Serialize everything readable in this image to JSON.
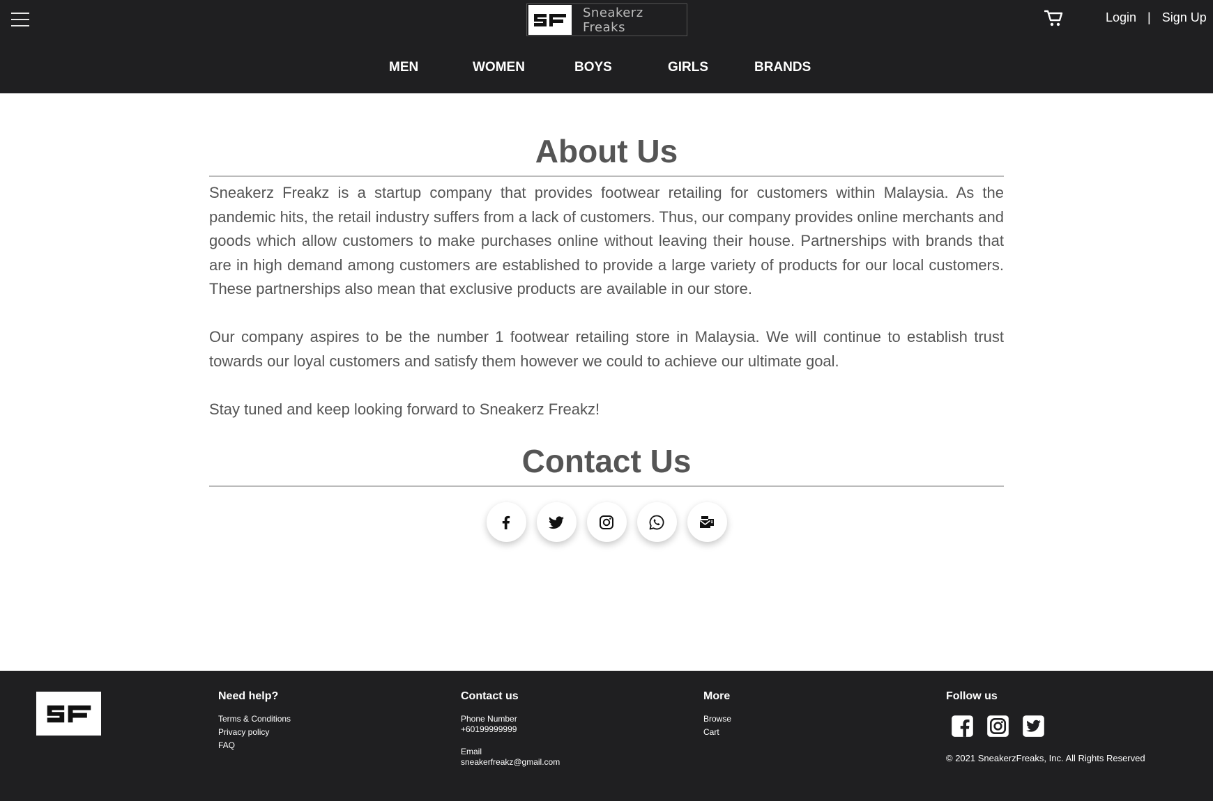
{
  "header": {
    "logo_text": "Sneakerz Freaks",
    "login_label": "Login",
    "separator": "|",
    "signup_label": "Sign Up",
    "nav": [
      "MEN",
      "WOMEN",
      "BOYS",
      "GIRLS",
      "BRANDS"
    ]
  },
  "about": {
    "title": "About Us",
    "paragraphs": [
      "Sneakerz Freakz is a startup company that provides footwear retailing for customers within Malaysia. As the pandemic hits, the retail industry suffers from a lack of customers. Thus, our company provides online merchants and goods which allow customers to make purchases online without leaving their house. Partnerships with brands that are in high demand among customers are established to provide a large variety of products for our local customers. These partnerships also mean that exclusive products are available in our store.",
      "Our company aspires to be the number 1 footwear retailing store in Malaysia. We will continue to establish trust towards our loyal customers and satisfy them however we could to achieve our ultimate goal.",
      "Stay tuned and keep looking forward to Sneakerz Freakz!"
    ]
  },
  "contact": {
    "title": "Contact Us",
    "socials": [
      "facebook-icon",
      "twitter-icon",
      "instagram-icon",
      "whatsapp-icon",
      "mail-icon"
    ]
  },
  "footer": {
    "help": {
      "title": "Need help?",
      "links": [
        "Terms & Conditions",
        "Privacy policy",
        "FAQ"
      ]
    },
    "contact": {
      "title": "Contact us",
      "phone_label": "Phone Number",
      "phone": "+60199999999",
      "email_label": "Email",
      "email": "sneakerfreakz@gmail.com"
    },
    "more": {
      "title": "More",
      "links": [
        "Browse",
        "Cart"
      ]
    },
    "follow": {
      "title": "Follow us",
      "icons": [
        "facebook-square-icon",
        "instagram-square-icon",
        "twitter-square-icon"
      ],
      "copyright": "© 2021 SneakerzFreaks, Inc. All Rights Reserved"
    }
  },
  "colors": {
    "header_bg": "#1f1f21",
    "text_gray": "#555555"
  }
}
